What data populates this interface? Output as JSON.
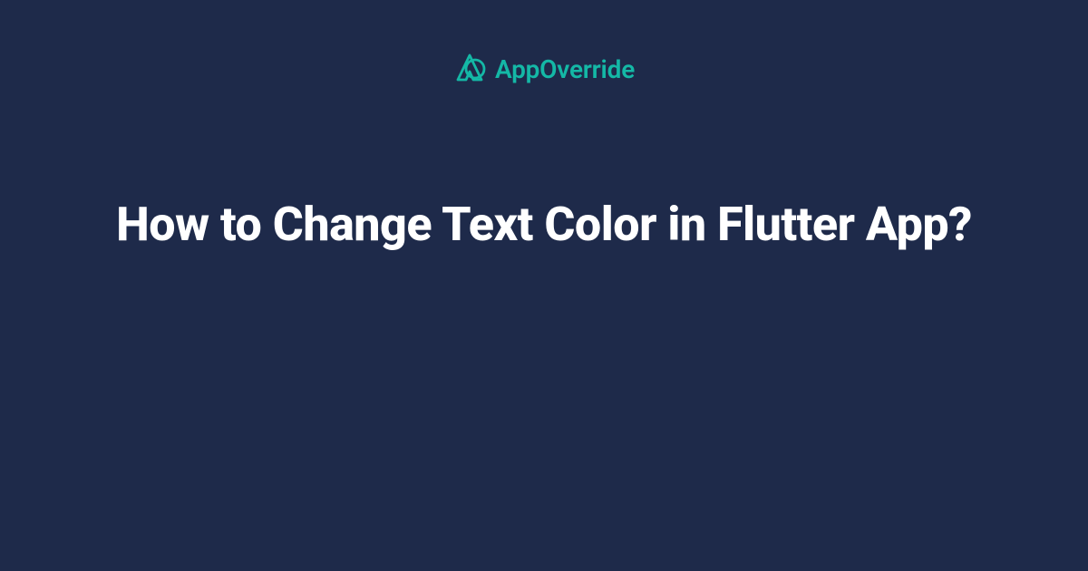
{
  "brand": {
    "name": "AppOverride",
    "accent_color": "#14b8a6"
  },
  "headline": "How to Change Text Color in Flutter App?",
  "colors": {
    "background": "#1e2a4a",
    "text": "#ffffff",
    "accent": "#14b8a6"
  }
}
